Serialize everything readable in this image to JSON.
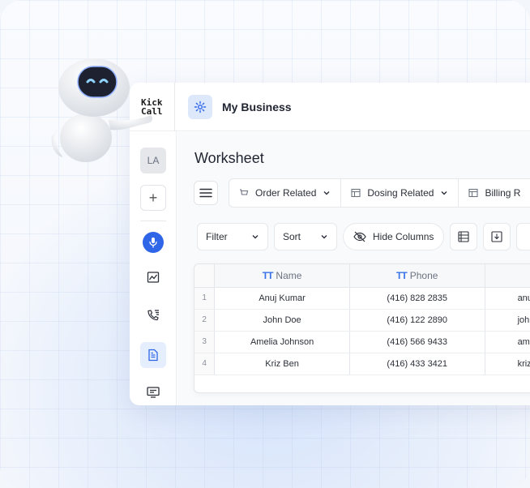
{
  "app": {
    "logo_line1": "Kick",
    "logo_line2": "Call",
    "business_name": "My Business"
  },
  "sidebar": {
    "avatar_initials": "LA",
    "plus": "+"
  },
  "main": {
    "title": "Worksheet",
    "tabs": [
      {
        "label": "Order Related"
      },
      {
        "label": "Dosing Related"
      },
      {
        "label": "Billing R"
      }
    ],
    "tools": {
      "filter": "Filter",
      "sort": "Sort",
      "hide_columns": "Hide Columns"
    }
  },
  "table": {
    "headers": {
      "name": "Name",
      "phone": "Phone"
    },
    "header_icon_text": "TT",
    "rows": [
      {
        "index": "1",
        "name": "Anuj Kumar",
        "phone": "(416) 828 2835",
        "extra": "anu"
      },
      {
        "index": "2",
        "name": "John Doe",
        "phone": "(416) 122 2890",
        "extra": "joh"
      },
      {
        "index": "3",
        "name": "Amelia Johnson",
        "phone": "(416) 566 9433",
        "extra": "am"
      },
      {
        "index": "4",
        "name": "Kriz Ben",
        "phone": "(416) 433 3421",
        "extra": "kriz"
      }
    ]
  },
  "colors": {
    "accent": "#2f66e8",
    "active_nav_bg": "#e4eefc"
  },
  "icons": [
    "gear-icon",
    "menu-icon",
    "cart-icon",
    "table-icon",
    "chevron-down-icon",
    "eye-off-icon",
    "list-icon",
    "download-icon",
    "mic-icon",
    "chart-icon",
    "phone-list-icon",
    "document-icon",
    "screen-icon"
  ]
}
